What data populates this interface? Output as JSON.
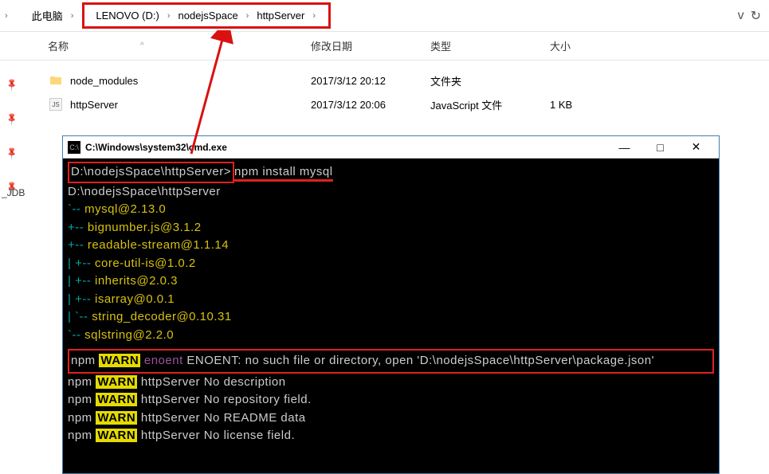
{
  "breadcrumb": {
    "this_pc": "此电脑",
    "items": [
      "LENOVO (D:)",
      "nodejsSpace",
      "httpServer"
    ]
  },
  "nav": {
    "down": "v",
    "refresh": "↻"
  },
  "left_label": "_JDB",
  "columns": {
    "name": "名称",
    "date": "修改日期",
    "type": "类型",
    "size": "大小",
    "sort": "^"
  },
  "files": [
    {
      "name": "node_modules",
      "date": "2017/3/12 20:12",
      "type": "文件夹",
      "size": "",
      "kind": "folder"
    },
    {
      "name": "httpServer",
      "date": "2017/3/12 20:06",
      "type": "JavaScript 文件",
      "size": "1 KB",
      "kind": "js"
    }
  ],
  "cmd": {
    "title": "C:\\Windows\\system32\\cmd.exe",
    "controls": {
      "min": "—",
      "max": "□",
      "close": "✕"
    },
    "prompt_path": "D:\\nodejsSpace\\httpServer>",
    "command": "npm install mysql",
    "line2": "D:\\nodejsSpace\\httpServer",
    "packages": [
      "`-- mysql@2.13.0",
      "  +-- bignumber.js@3.1.2",
      "  +-- readable-stream@1.1.14",
      "  | +-- core-util-is@1.0.2",
      "  | +-- inherits@2.0.3",
      "  | +-- isarray@0.0.1",
      "  | `-- string_decoder@0.10.31",
      "  `-- sqlstring@2.2.0"
    ],
    "warn_enoent": {
      "prefix": "npm",
      "warn": "WARN",
      "code": "enoent",
      "msg": " ENOENT: no such file or directory, open 'D:\\nodejsSpace\\httpServer\\package.json'"
    },
    "warns": [
      " httpServer No description",
      " httpServer No repository field.",
      " httpServer No README data",
      " httpServer No license field."
    ]
  }
}
